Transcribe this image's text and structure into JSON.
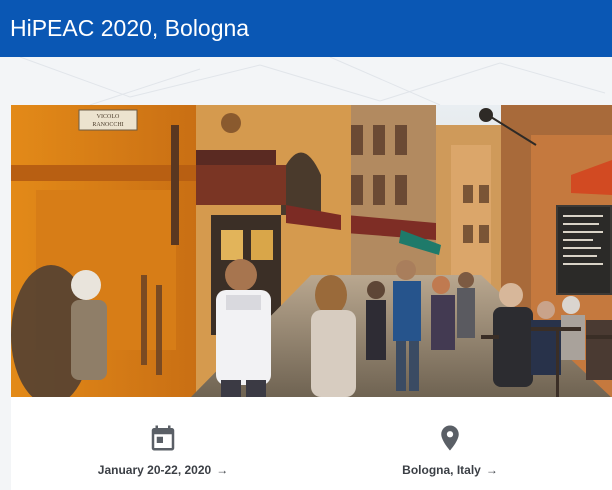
{
  "header": {
    "title": "HiPEAC 2020, Bologna"
  },
  "hero": {
    "street_sign": "VICOLO\nRANOCCHI"
  },
  "event": {
    "date_label": "January 20-22, 2020",
    "location_label": "Bologna, Italy",
    "date_icon": "calendar-icon",
    "location_icon": "map-pin-icon",
    "arrow_glyph": "→"
  },
  "colors": {
    "header_bg": "#0a57b4",
    "text": "#3b3f45",
    "icon": "#5a5f66"
  }
}
